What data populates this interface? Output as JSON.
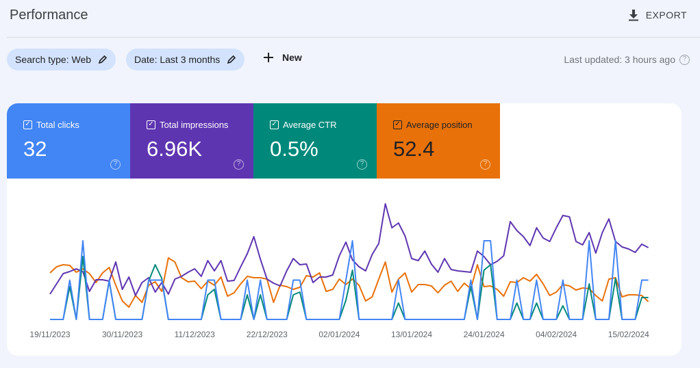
{
  "header": {
    "title": "Performance",
    "export_label": "EXPORT",
    "export_icon": "download-icon"
  },
  "filters": [
    {
      "label": "Search type: Web",
      "icon": "pencil-icon"
    },
    {
      "label": "Date: Last 3 months",
      "icon": "pencil-icon"
    }
  ],
  "new_label": "New",
  "last_updated": "Last updated: 3 hours ago",
  "metrics": [
    {
      "label": "Total clicks",
      "value": "32",
      "color": "#4285f4",
      "checked": true
    },
    {
      "label": "Total impressions",
      "value": "6.96K",
      "color": "#5e35b1",
      "checked": true
    },
    {
      "label": "Average CTR",
      "value": "0.5%",
      "color": "#00897b",
      "checked": true
    },
    {
      "label": "Average position",
      "value": "52.4",
      "color": "#e8710a",
      "checked": true
    }
  ],
  "chart_data": {
    "type": "line",
    "grid": false,
    "x_ticks": [
      "19/11/2023",
      "30/11/2023",
      "11/12/2023",
      "22/12/2023",
      "02/01/2024",
      "13/01/2024",
      "24/01/2024",
      "04/02/2024",
      "15/02/2024"
    ],
    "x": [
      "19/11/2023",
      "20/11/2023",
      "21/11/2023",
      "22/11/2023",
      "23/11/2023",
      "24/11/2023",
      "25/11/2023",
      "26/11/2023",
      "27/11/2023",
      "28/11/2023",
      "29/11/2023",
      "30/11/2023",
      "01/12/2023",
      "02/12/2023",
      "03/12/2023",
      "04/12/2023",
      "05/12/2023",
      "06/12/2023",
      "07/12/2023",
      "08/12/2023",
      "09/12/2023",
      "10/12/2023",
      "11/12/2023",
      "12/12/2023",
      "13/12/2023",
      "14/12/2023",
      "15/12/2023",
      "16/12/2023",
      "17/12/2023",
      "18/12/2023",
      "19/12/2023",
      "20/12/2023",
      "21/12/2023",
      "22/12/2023",
      "23/12/2023",
      "24/12/2023",
      "25/12/2023",
      "26/12/2023",
      "27/12/2023",
      "28/12/2023",
      "29/12/2023",
      "30/12/2023",
      "31/12/2023",
      "01/01/2024",
      "02/01/2024",
      "03/01/2024",
      "04/01/2024",
      "05/01/2024",
      "06/01/2024",
      "07/01/2024",
      "08/01/2024",
      "09/01/2024",
      "10/01/2024",
      "11/01/2024",
      "12/01/2024",
      "13/01/2024",
      "14/01/2024",
      "15/01/2024",
      "16/01/2024",
      "17/01/2024",
      "18/01/2024",
      "19/01/2024",
      "20/01/2024",
      "21/01/2024",
      "22/01/2024",
      "23/01/2024",
      "24/01/2024",
      "25/01/2024",
      "26/01/2024",
      "27/01/2024",
      "28/01/2024",
      "29/01/2024",
      "30/01/2024",
      "31/01/2024",
      "01/02/2024",
      "02/02/2024",
      "03/02/2024",
      "04/02/2024",
      "05/02/2024",
      "06/02/2024",
      "07/02/2024",
      "08/02/2024",
      "09/02/2024",
      "10/02/2024",
      "11/02/2024",
      "12/02/2024",
      "13/02/2024",
      "14/02/2024",
      "15/02/2024",
      "16/02/2024",
      "17/02/2024",
      "18/02/2024"
    ],
    "series": [
      {
        "name": "Total clicks",
        "color": "#4285f4",
        "values": [
          0,
          0,
          0,
          1,
          0,
          2,
          0,
          0,
          0,
          1,
          0,
          0,
          0,
          0,
          0,
          1,
          1,
          1,
          0,
          0,
          0,
          0,
          0,
          0,
          1,
          1,
          0,
          0,
          0,
          0,
          1,
          0,
          1,
          0,
          0,
          0,
          0,
          1,
          1,
          0,
          0,
          0,
          0,
          0,
          0,
          1,
          2,
          0,
          0,
          0,
          0,
          0,
          0,
          1,
          0,
          0,
          0,
          0,
          0,
          0,
          0,
          0,
          0,
          0,
          1,
          0,
          2,
          2,
          0,
          0,
          0,
          1,
          0,
          0,
          1,
          0,
          0,
          0,
          1,
          0,
          0,
          0,
          2,
          0,
          0,
          0,
          2,
          0,
          0,
          0,
          1,
          1
        ]
      },
      {
        "name": "Total impressions",
        "color": "#5e35b1",
        "values": [
          37,
          52,
          67,
          70,
          74,
          70,
          41,
          58,
          58,
          56,
          84,
          44,
          62,
          35,
          54,
          61,
          40,
          54,
          37,
          59,
          63,
          69,
          74,
          63,
          86,
          71,
          86,
          56,
          57,
          77,
          96,
          121,
          88,
          59,
          53,
          49,
          71,
          89,
          80,
          81,
          54,
          62,
          62,
          65,
          93,
          113,
          87,
          77,
          71,
          95,
          111,
          169,
          134,
          141,
          122,
          89,
          86,
          100,
          81,
          69,
          89,
          73,
          71,
          70,
          69,
          100,
          92,
          80,
          85,
          93,
          143,
          130,
          121,
          108,
          134,
          119,
          114,
          134,
          152,
          150,
          114,
          109,
          127,
          97,
          127,
          147,
          114,
          106,
          103,
          98,
          110,
          105
        ]
      },
      {
        "name": "Average CTR",
        "color": "#00897b",
        "values": [
          0,
          0,
          0,
          1.2,
          0,
          2.3,
          0,
          0,
          0,
          1.4,
          0,
          0,
          0,
          0,
          0,
          1.4,
          2.0,
          1.5,
          0,
          0,
          0,
          0,
          0,
          0,
          0.9,
          1.1,
          0,
          0,
          0,
          0,
          0.9,
          0,
          0.9,
          0,
          0,
          0,
          0,
          0.9,
          1.0,
          0,
          0,
          0,
          0,
          0,
          0,
          0.7,
          1.8,
          0,
          0,
          0,
          0,
          0,
          0,
          0.6,
          0,
          0,
          0,
          0,
          0,
          0,
          0,
          0,
          0,
          0,
          1.2,
          0,
          1.8,
          2.0,
          0,
          0,
          0,
          0.6,
          0,
          0,
          0.6,
          0,
          0,
          0,
          0.5,
          0,
          0,
          0,
          1.3,
          0,
          0,
          0,
          1.5,
          0,
          0,
          0,
          0.8,
          0.8
        ]
      },
      {
        "name": "Average position",
        "color": "#e8710a",
        "inverted": true,
        "values": [
          36,
          27,
          24,
          25,
          35,
          30,
          37,
          50,
          36,
          28,
          54,
          77,
          86,
          69,
          79,
          54,
          49,
          63,
          14,
          20,
          43,
          49,
          48,
          59,
          48,
          54,
          42,
          70,
          65,
          52,
          41,
          43,
          43,
          45,
          79,
          54,
          56,
          60,
          57,
          40,
          42,
          36,
          63,
          60,
          45,
          53,
          45,
          54,
          77,
          71,
          45,
          20,
          64,
          45,
          36,
          64,
          53,
          53,
          55,
          65,
          54,
          48,
          63,
          51,
          59,
          24,
          56,
          55,
          60,
          70,
          49,
          50,
          43,
          48,
          38,
          52,
          69,
          64,
          53,
          55,
          61,
          58,
          59,
          69,
          77,
          45,
          43,
          71,
          68,
          68,
          69,
          78
        ]
      }
    ]
  }
}
